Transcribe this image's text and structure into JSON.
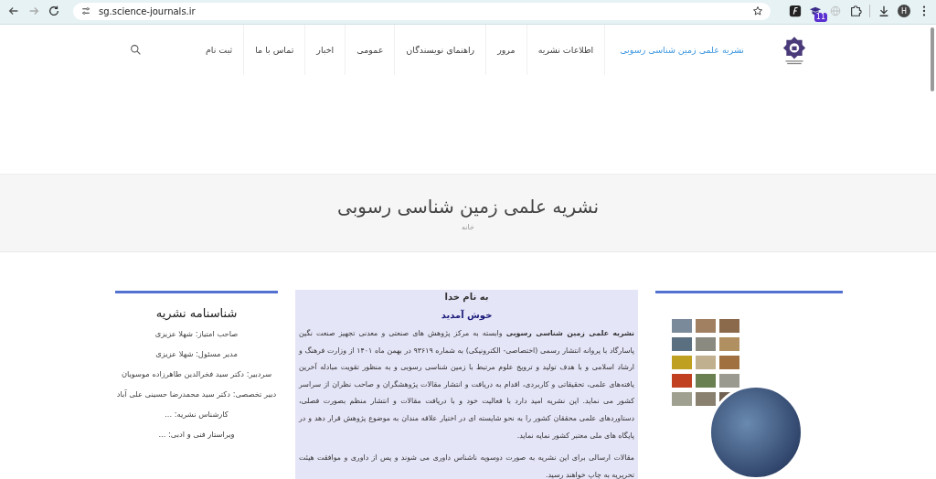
{
  "browser": {
    "url": "sg.science-journals.ir",
    "extension_badge": "11",
    "profile_initial": "H"
  },
  "nav": {
    "items": [
      {
        "label": "نشریه علمی زمین شناسی رسوبی",
        "selected": true
      },
      {
        "label": "اطلاعات نشریه",
        "selected": false
      },
      {
        "label": "مرور",
        "selected": false
      },
      {
        "label": "راهنمای نویسندگان",
        "selected": false
      },
      {
        "label": "عمومی",
        "selected": false
      },
      {
        "label": "اخبار",
        "selected": false
      },
      {
        "label": "تماس با ما",
        "selected": false
      },
      {
        "label": "ثبت نام",
        "selected": false
      }
    ]
  },
  "page_header": {
    "title": "نشریه علمی زمین شناسی رسوبی",
    "breadcrumb": "خانه"
  },
  "sidebar": {
    "title": "شناسنامه نشریه",
    "items": [
      "صاحب امتیاز: شهلا عزیزی",
      "مدیر مسئول: شهلا عزیزی",
      "سردبیر: دکتر سید فخرالدین طاهرزاده موسویان",
      "دبیر تخصصی: دکتر سید محمدرضا حسینی علی آباد",
      "کارشناس نشریه: ...",
      "ویراستار فنی و ادبی: ..."
    ]
  },
  "intro": {
    "heading": "به نام خدا",
    "welcome": "خوش آمدید",
    "paragraphs": [
      "**نشریه علمی زمین شناسی رسوبی** وابسته به مرکز پژوهش های صنعتی و معدنی تجهیز صنعت نگین پاسارگاد با پروانه انتشار رسمی (اختصاصی- الکترونیکی) به شماره ۹۳۶۱۹ در بهمن ماه ۱۴۰۱ از وزارت فرهنگ و ارشاد اسلامی و با هدف تولید و ترویج علوم مرتبط با زمین شناسی رسوبی و به منظور تقویت مبادله آخرین یافته‌های علمی، تحقیقاتی و کاربردی، اقدام به دریافت و انتشار مقالات پژوهشگران و صاحب نظران از سراسر کشور می نماید. این نشریه امید دارد با فعالیت خود و با دریافت مقالات و انتشار منظم بصورت فصلی، دستاوردهای علمی  محققان کشور را به نحو شایسته ای در اختیار علاقه مندان به موضوع پژوهش قرار دهد و در پایگاه های ملی معتبر کشور نمایه نماید.",
      "مقالات ارسالی برای این نشریه به صورت دوسویه ناشناس داوری می شوند و پس از داوری و موافقت هیئت تحریریه به چاپ خواهند رسید."
    ]
  }
}
